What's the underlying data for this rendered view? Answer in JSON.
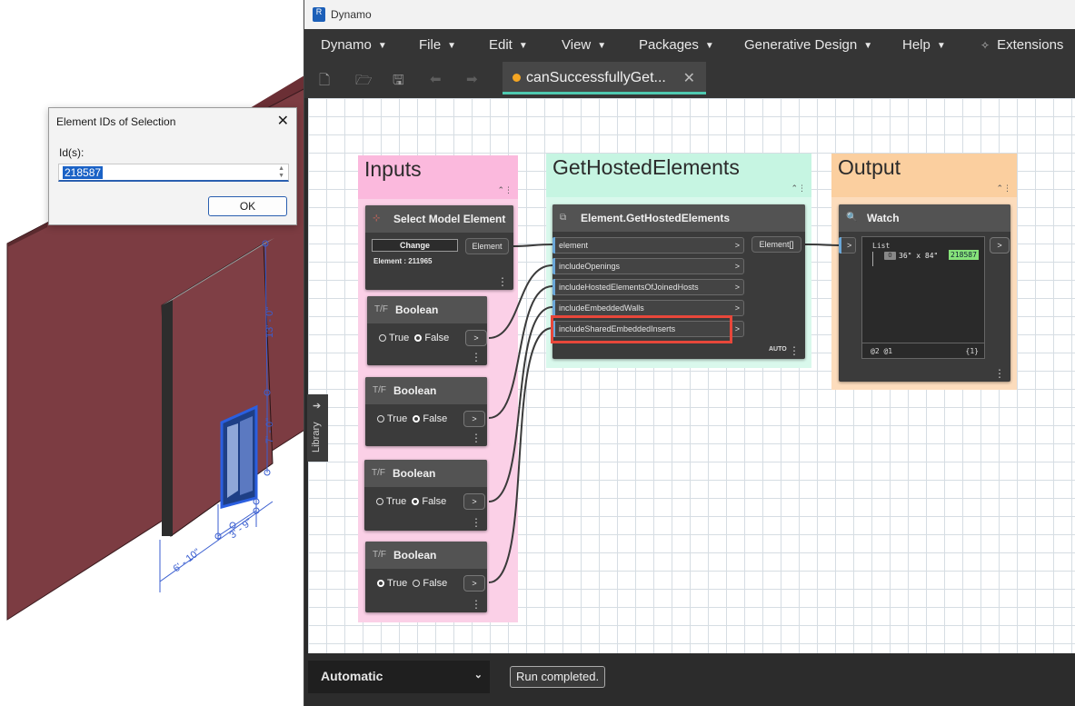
{
  "revit": {
    "dims": {
      "height_upper": "13' - 0\"",
      "height_lower": "7' - 0\"",
      "width_small": "3' - 9\"",
      "width_large": "6' - 10\""
    }
  },
  "element_ids_dialog": {
    "title": "Element IDs of Selection",
    "field_label": "Id(s):",
    "field_value": "218587",
    "ok_label": "OK"
  },
  "dynamo": {
    "window_title": "Dynamo",
    "menu": [
      "Dynamo",
      "File",
      "Edit",
      "View",
      "Packages",
      "Generative Design",
      "Help",
      "Extensions"
    ],
    "tab": {
      "name": "canSuccessfullyGet...",
      "modified": true
    },
    "library_label": "Library",
    "groups": {
      "inputs": {
        "title": "Inputs",
        "color": "#fbb9dd"
      },
      "hosted": {
        "title": "GetHostedElements",
        "color": "#c6f5e2"
      },
      "output": {
        "title": "Output",
        "color": "#fbcf9f"
      }
    },
    "nodes": {
      "select": {
        "title": "Select Model Element",
        "button": "Change",
        "output": "Element",
        "info": "Element : 211965"
      },
      "bool1": {
        "title": "Boolean",
        "true_label": "True",
        "false_label": "False",
        "value": false,
        "out": ">"
      },
      "bool2": {
        "title": "Boolean",
        "true_label": "True",
        "false_label": "False",
        "value": false,
        "out": ">"
      },
      "bool3": {
        "title": "Boolean",
        "true_label": "True",
        "false_label": "False",
        "value": false,
        "out": ">"
      },
      "bool4": {
        "title": "Boolean",
        "true_label": "True",
        "false_label": "False",
        "value": true,
        "out": ">"
      },
      "get_hosted": {
        "title": "Element.GetHostedElements",
        "inputs": [
          "element",
          "includeOpenings",
          "includeHostedElementsOfJoinedHosts",
          "includeEmbeddedWalls",
          "includeSharedEmbeddedInserts"
        ],
        "output": "Element[]",
        "lacing": "AUTO",
        "highlighted_input": "includeSharedEmbeddedInserts"
      },
      "watch": {
        "title": "Watch",
        "list_label": "List",
        "index": "0",
        "value": "36\" x 84\"",
        "element_id": "218587",
        "footer_left": "@2 @1",
        "footer_right": "{1}",
        "in": ">",
        "out": ">"
      }
    },
    "run_mode": "Automatic",
    "run_status": "Run completed."
  }
}
